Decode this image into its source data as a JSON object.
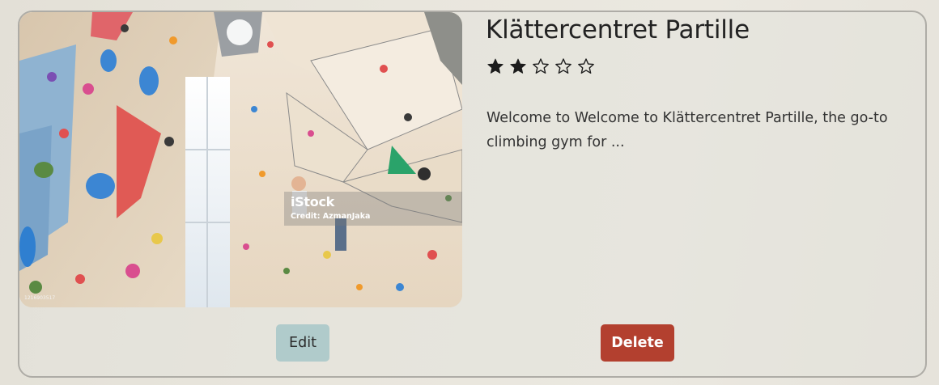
{
  "card": {
    "title": "Klättercentret Partille",
    "rating": {
      "value": 2,
      "max": 5
    },
    "description": "Welcome to Welcome to Klättercentret Partille, the go-to climbing gym for ...",
    "image": {
      "watermark_brand": "iStock",
      "watermark_credit": "Credit: AzmanJaka",
      "id_text": "1216903517"
    },
    "actions": {
      "edit_label": "Edit",
      "delete_label": "Delete"
    }
  },
  "colors": {
    "star_fill": "#1c1c1c",
    "edit_button": "#b0cbcb",
    "delete_button": "#b3402f"
  },
  "icons": {
    "star_filled": "star-filled-icon",
    "star_empty": "star-empty-icon"
  }
}
